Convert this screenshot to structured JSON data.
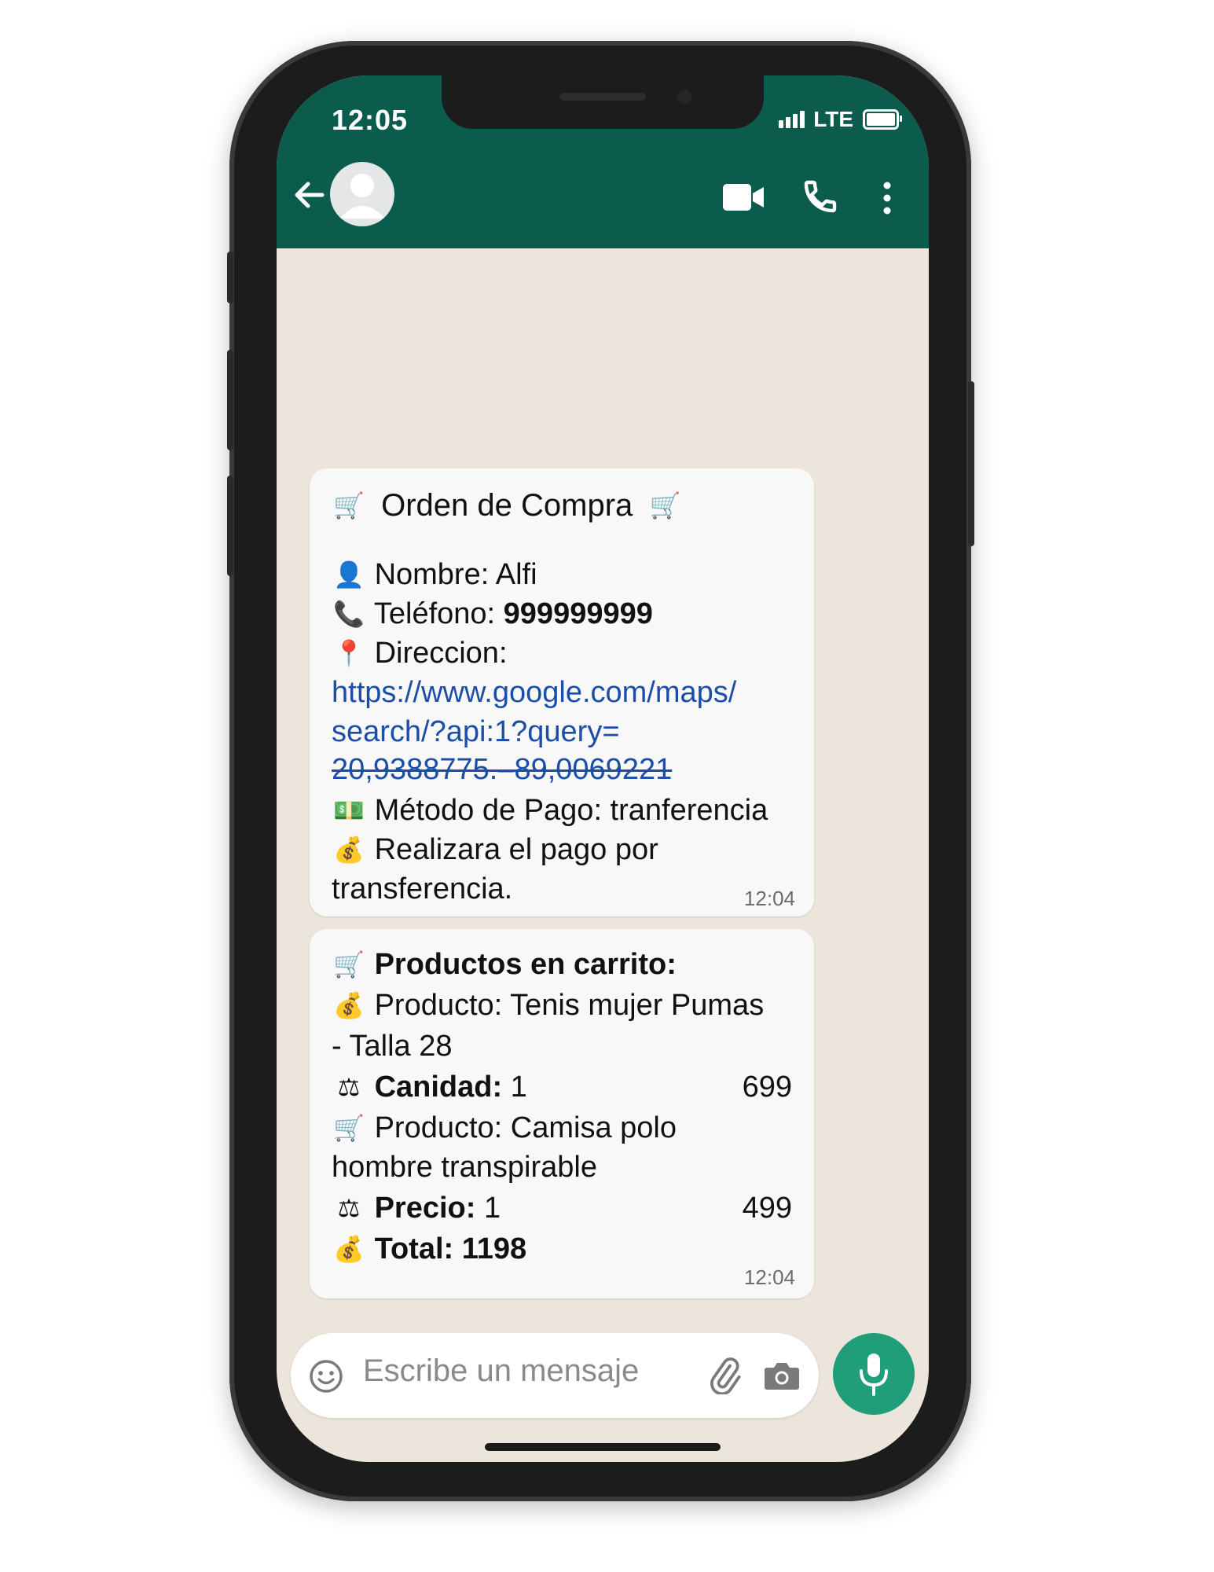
{
  "status_bar": {
    "time": "12:05",
    "network": "LTE"
  },
  "header": {
    "back_icon": "arrow-left-icon",
    "avatar_icon": "default-avatar-icon",
    "actions": [
      "video-call-icon",
      "phone-call-icon",
      "more-vertical-icon"
    ]
  },
  "messages": [
    {
      "title": "Orden de Compra",
      "name_label": "Nombre:",
      "name_value": " Alfi",
      "phone_label": "Teléfono:",
      "phone_value": " 999999999",
      "address_label": "Direccion:",
      "link_line1": "https://www.google.com/maps/",
      "link_line2": "search/?api:1?query=",
      "link_line3": "20,9388775.–89,0069221",
      "payment_method": "Método de Pago: tranferencia",
      "payment_note_line1": "Realizara el pago por",
      "payment_note_line2": "transferencia.",
      "time": "12:04"
    },
    {
      "cart_title": "Productos en carrito:",
      "product1_line1": "Producto: Tenis mujer Pumas",
      "product1_line2": "- Talla 28",
      "qty_label": "Canidad:",
      "qty_value": " 1",
      "product1_price": "699",
      "product2_line1": "Producto: Camisa polo",
      "product2_line2": "hombre transpirable",
      "price_label": "Precio:",
      "price_value": " 1",
      "product2_price": "499",
      "total": "Total: 1198",
      "time": "12:04"
    }
  ],
  "composer": {
    "placeholder": "Escribe un mensaje",
    "emoji_icon": "emoji-icon",
    "attach_icon": "paperclip-icon",
    "camera_icon": "camera-icon",
    "mic_icon": "microphone-icon"
  },
  "colors": {
    "header": "#0b5c4d",
    "chat_background": "#ece5dc",
    "bubble": "#f8f8f8",
    "link": "#1a4ea8",
    "mic_button": "#1f9e79"
  }
}
